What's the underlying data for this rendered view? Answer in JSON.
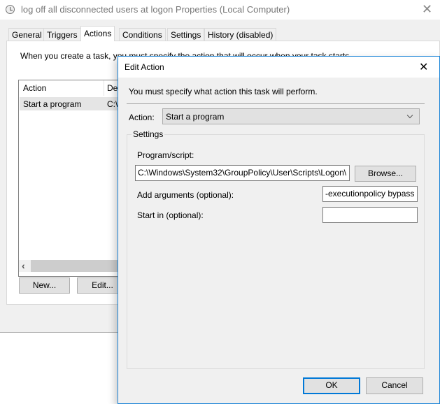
{
  "window": {
    "title": "log off all disconnected users at logon Properties (Local Computer)",
    "close": "✕"
  },
  "tabs": [
    {
      "label": "General"
    },
    {
      "label": "Triggers"
    },
    {
      "label": "Actions",
      "selected": true
    },
    {
      "label": "Conditions"
    },
    {
      "label": "Settings"
    },
    {
      "label": "History (disabled)"
    }
  ],
  "actions_tab": {
    "intro": "When you create a task, you must specify the action that will occur when your task starts.",
    "columns": [
      "Action",
      "De"
    ],
    "rows": [
      {
        "action": "Start a program",
        "details": "C:\\"
      }
    ],
    "buttons": {
      "new": "New...",
      "edit": "Edit..."
    },
    "scroll_left": "‹"
  },
  "dialog": {
    "title": "Edit Action",
    "close": "✕",
    "instruction": "You must specify what action this task will perform.",
    "action_label": "Action:",
    "action_value": "Start a program",
    "settings_label": "Settings",
    "program_label": "Program/script:",
    "program_value": "C:\\Windows\\System32\\GroupPolicy\\User\\Scripts\\Logon\\",
    "browse": "Browse...",
    "arguments_label": "Add arguments (optional):",
    "arguments_value": "-executionpolicy bypass",
    "start_in_label": "Start in (optional):",
    "start_in_value": "",
    "ok": "OK",
    "cancel": "Cancel"
  },
  "colors": {
    "accent": "#0078d7",
    "selected_row": "#e5e5e5"
  }
}
